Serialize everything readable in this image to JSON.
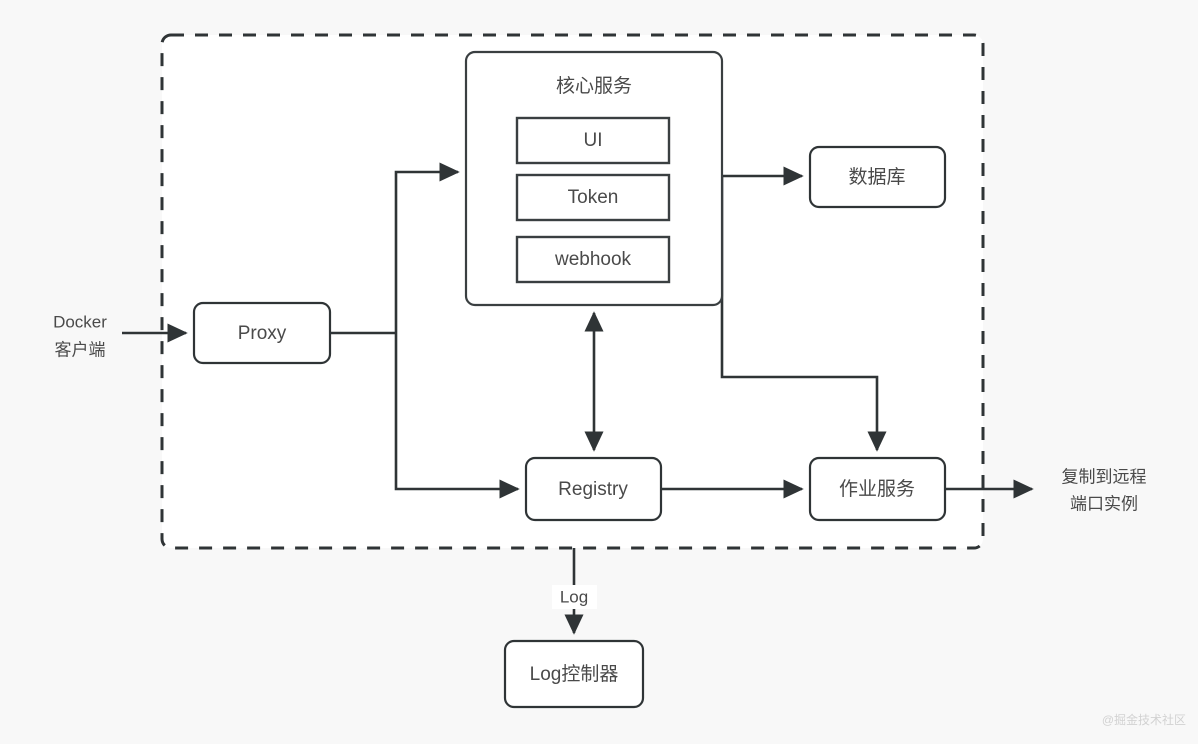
{
  "diagram": {
    "type": "architecture-flow-diagram",
    "background_color": "#f8f8f8",
    "boundary_color": "#2f3436",
    "node_fill": "#ffffff",
    "text_color": "#4a4a4a",
    "boundary": {
      "style": "dashed",
      "label": ""
    },
    "external_nodes": [
      {
        "id": "docker-client",
        "lines": [
          "Docker",
          "客户端"
        ],
        "line1": "Docker",
        "line2": "客户端",
        "position": "left"
      },
      {
        "id": "remote-replica",
        "lines": [
          "复制到远程",
          "端口实例"
        ],
        "line1": "复制到远程",
        "line2": "端口实例",
        "position": "right"
      }
    ],
    "nodes": [
      {
        "id": "proxy",
        "label": "Proxy"
      },
      {
        "id": "core-services",
        "label": "核心服务"
      },
      {
        "id": "ui",
        "label": "UI"
      },
      {
        "id": "token",
        "label": "Token"
      },
      {
        "id": "webhook",
        "label": "webhook"
      },
      {
        "id": "database",
        "label": "数据库"
      },
      {
        "id": "registry",
        "label": "Registry"
      },
      {
        "id": "job-service",
        "label": "作业服务"
      },
      {
        "id": "log-controller",
        "label": "Log控制器"
      }
    ],
    "edge_labels": [
      {
        "id": "log-edge",
        "label": "Log"
      }
    ],
    "watermark": "@掘金技术社区"
  }
}
